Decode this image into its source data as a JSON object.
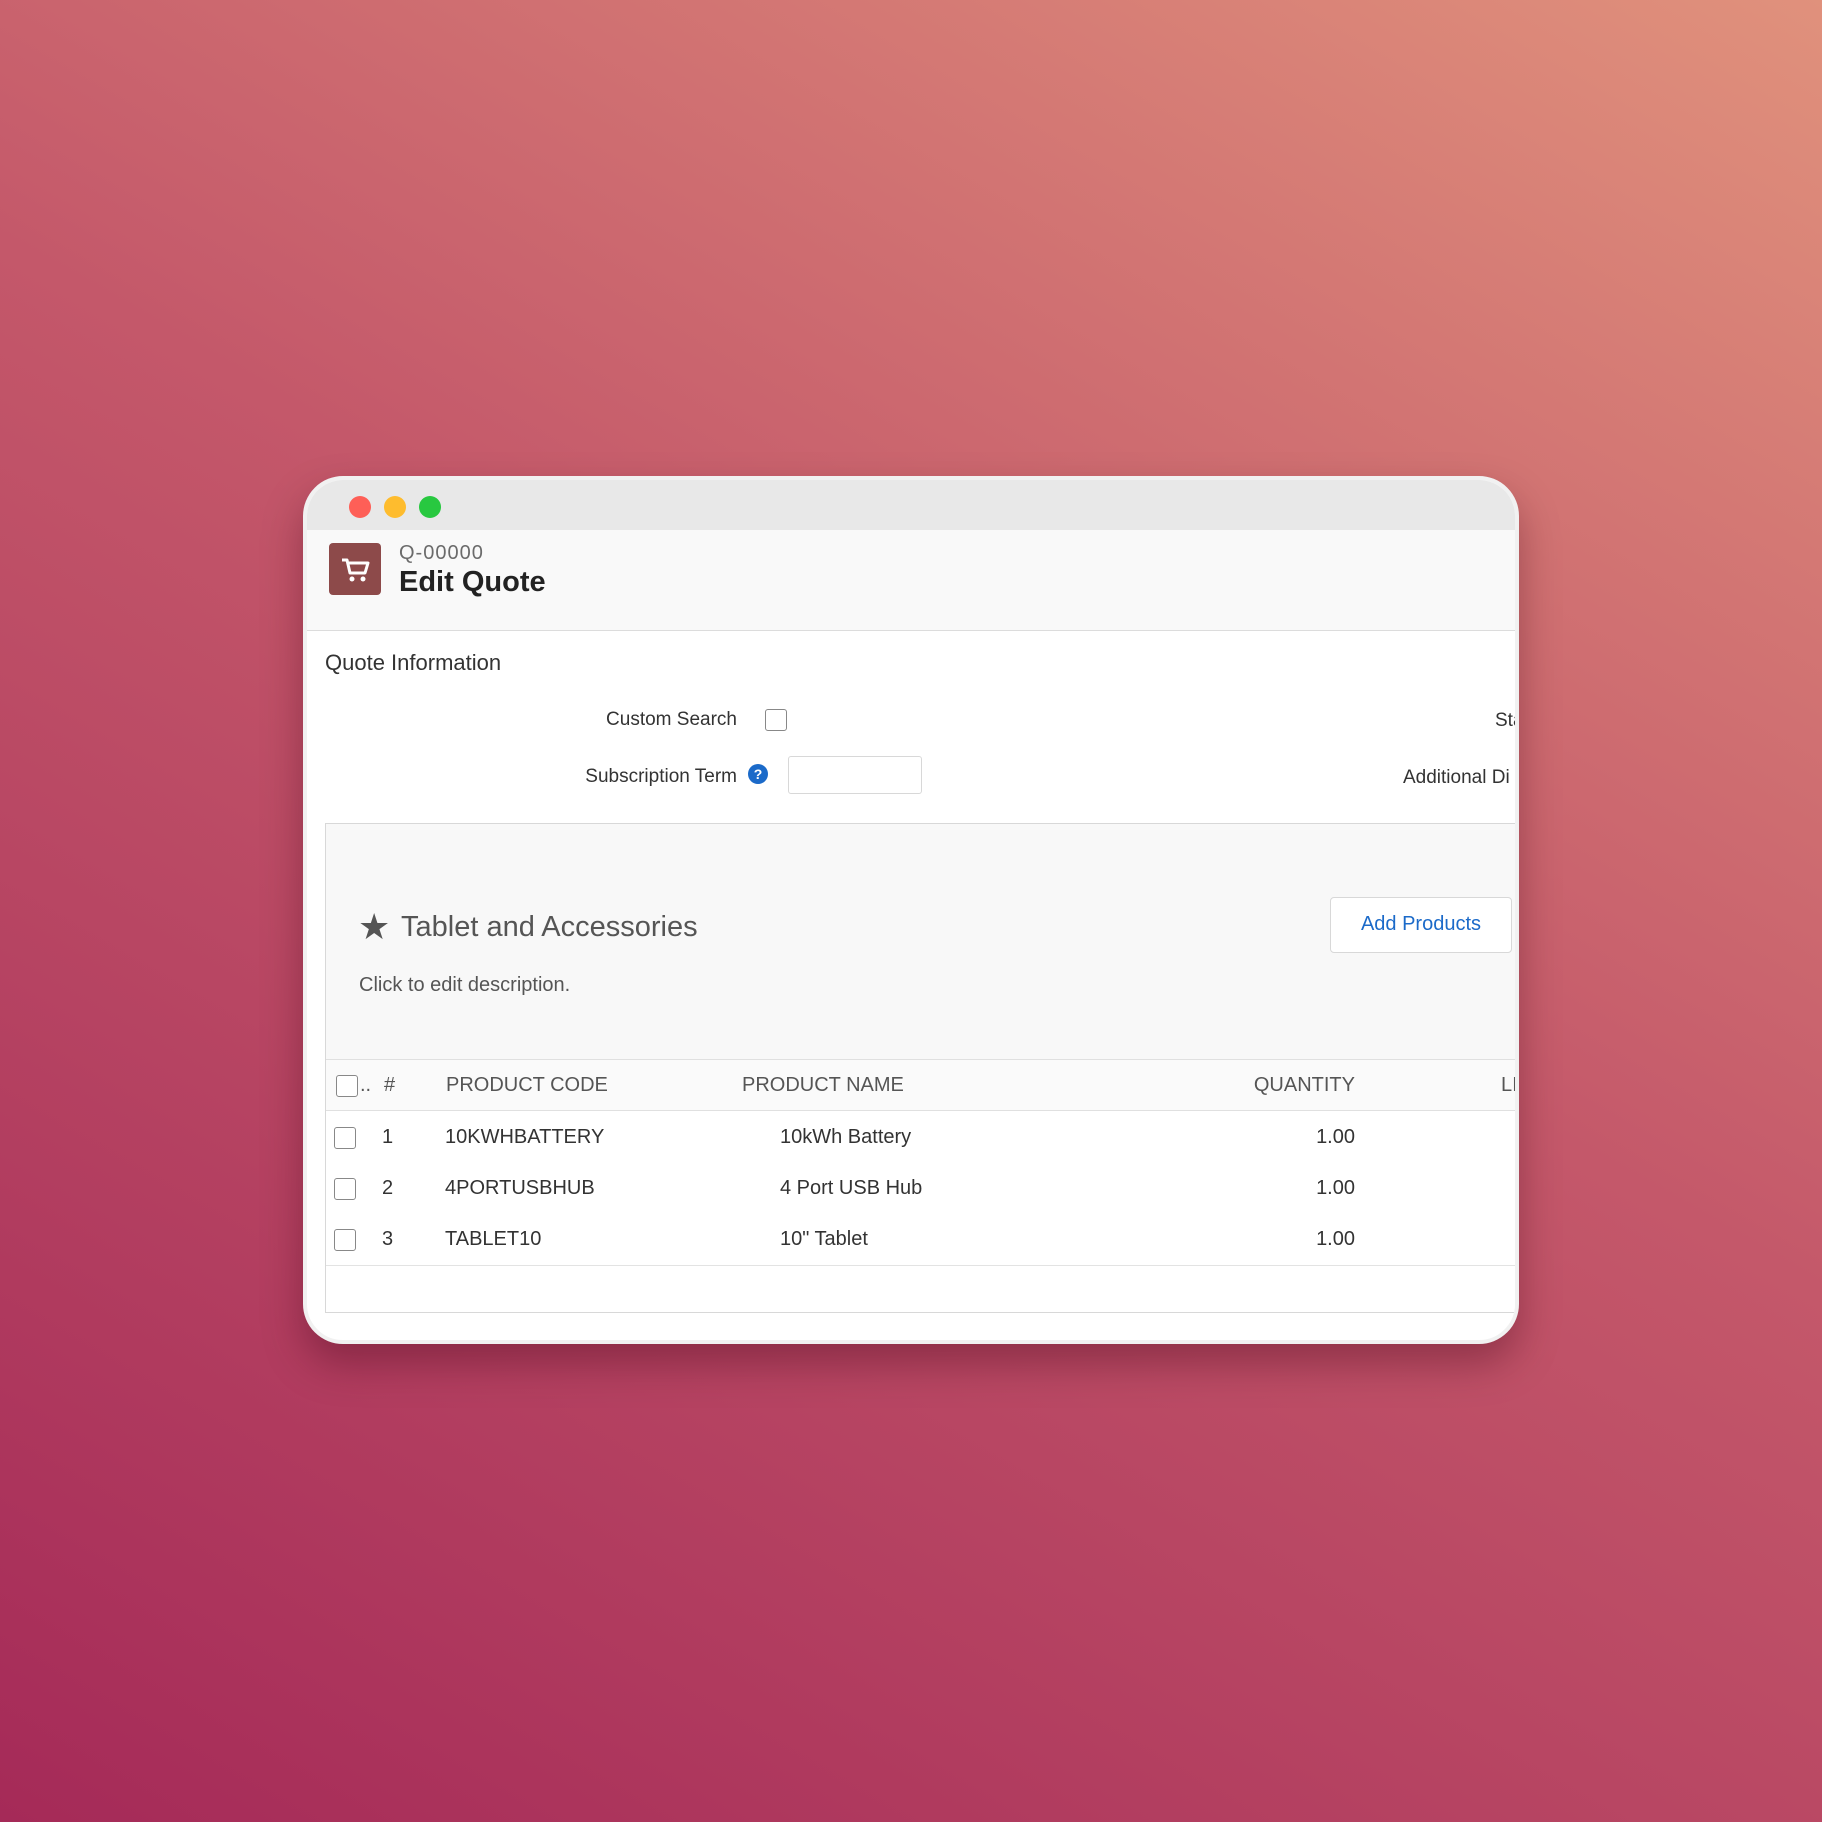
{
  "window": {
    "controls": [
      "close",
      "minimize",
      "maximize"
    ]
  },
  "header": {
    "icon": "cart-icon",
    "quote_number": "Q-00000",
    "title": "Edit Quote"
  },
  "quote_info": {
    "section_title": "Quote Information",
    "custom_search_label": "Custom Search",
    "custom_search_checked": false,
    "subscription_term_label": "Subscription Term",
    "subscription_term_value": "",
    "right_label_1": "Sta",
    "right_label_2": "Additional Di"
  },
  "group": {
    "title": "Tablet and Accessories",
    "description": "Click to edit description.",
    "add_products_label": "Add Products"
  },
  "table": {
    "headers": {
      "select": "..",
      "num": "#",
      "product_code": "PRODUCT CODE",
      "product_name": "PRODUCT NAME",
      "quantity": "QUANTITY",
      "list": "LI"
    },
    "rows": [
      {
        "num": "1",
        "code": "10KWHBATTERY",
        "name": "10kWh Battery",
        "quantity": "1.00"
      },
      {
        "num": "2",
        "code": "4PORTUSBHUB",
        "name": "4 Port USB Hub",
        "quantity": "1.00"
      },
      {
        "num": "3",
        "code": "TABLET10",
        "name": "10\" Tablet",
        "quantity": "1.00"
      }
    ]
  }
}
